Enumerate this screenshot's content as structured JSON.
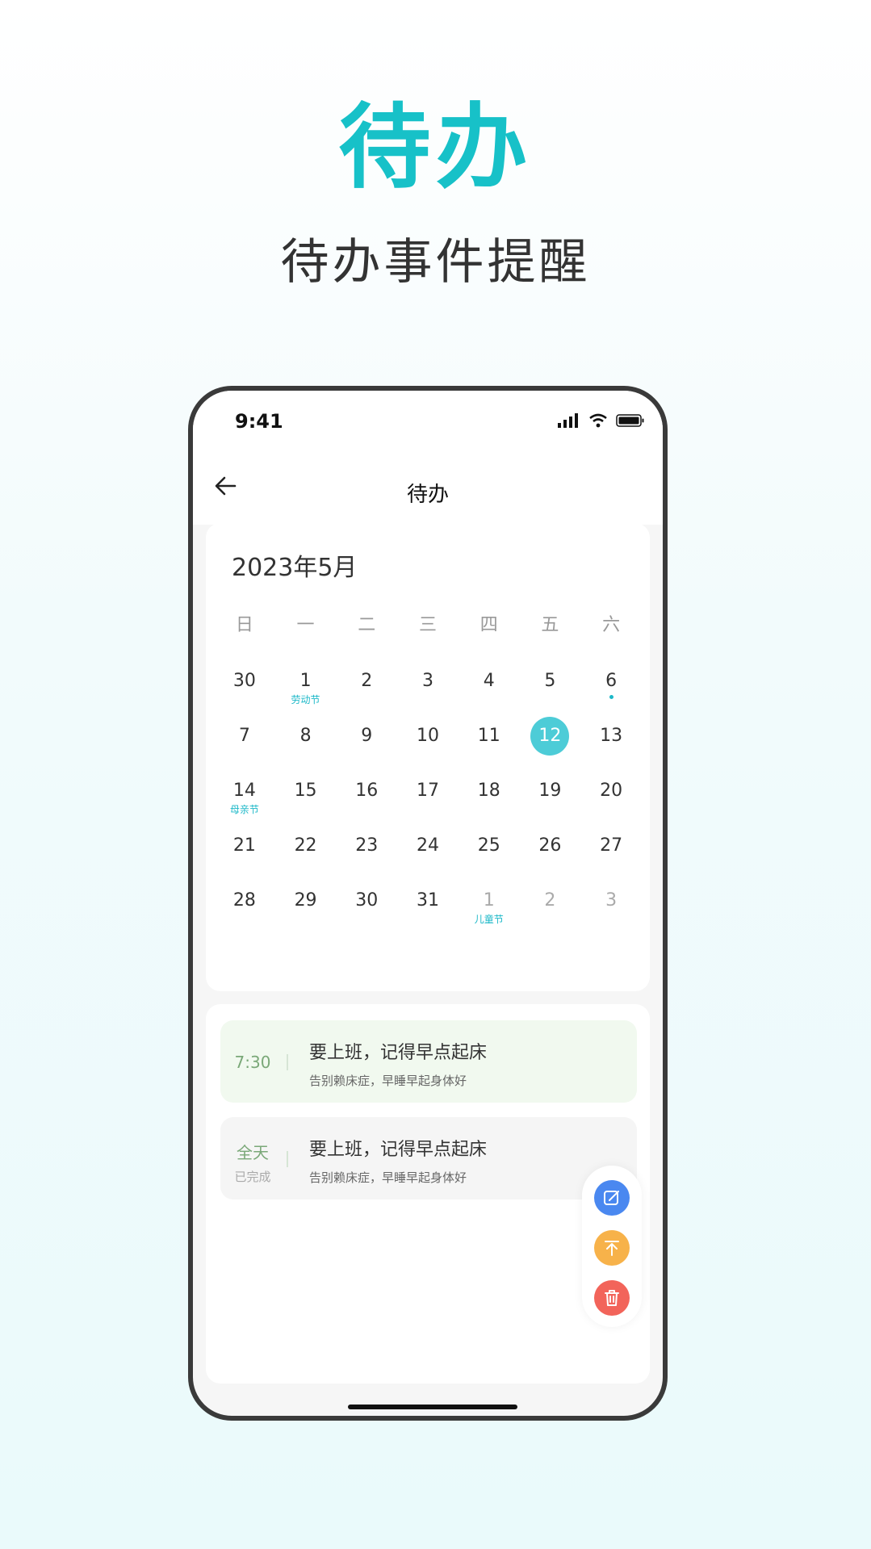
{
  "hero": {
    "title": "待办",
    "subtitle": "待办事件提醒"
  },
  "status_bar": {
    "time": "9:41"
  },
  "nav": {
    "title": "待办"
  },
  "calendar": {
    "month_label": "2023年5月",
    "weekdays": [
      "日",
      "一",
      "二",
      "三",
      "四",
      "五",
      "六"
    ],
    "days": [
      {
        "num": "30",
        "muted": false,
        "note": ""
      },
      {
        "num": "1",
        "muted": false,
        "note": "劳动节"
      },
      {
        "num": "2",
        "muted": false,
        "note": ""
      },
      {
        "num": "3",
        "muted": false,
        "note": ""
      },
      {
        "num": "4",
        "muted": false,
        "note": ""
      },
      {
        "num": "5",
        "muted": false,
        "note": ""
      },
      {
        "num": "6",
        "muted": false,
        "note": "",
        "dot": true
      },
      {
        "num": "7",
        "muted": false,
        "note": ""
      },
      {
        "num": "8",
        "muted": false,
        "note": ""
      },
      {
        "num": "9",
        "muted": false,
        "note": ""
      },
      {
        "num": "10",
        "muted": false,
        "note": ""
      },
      {
        "num": "11",
        "muted": false,
        "note": ""
      },
      {
        "num": "12",
        "muted": false,
        "note": "",
        "selected": true
      },
      {
        "num": "13",
        "muted": false,
        "note": ""
      },
      {
        "num": "14",
        "muted": false,
        "note": "母亲节"
      },
      {
        "num": "15",
        "muted": false,
        "note": ""
      },
      {
        "num": "16",
        "muted": false,
        "note": ""
      },
      {
        "num": "17",
        "muted": false,
        "note": ""
      },
      {
        "num": "18",
        "muted": false,
        "note": ""
      },
      {
        "num": "19",
        "muted": false,
        "note": ""
      },
      {
        "num": "20",
        "muted": false,
        "note": ""
      },
      {
        "num": "21",
        "muted": false,
        "note": ""
      },
      {
        "num": "22",
        "muted": false,
        "note": ""
      },
      {
        "num": "23",
        "muted": false,
        "note": ""
      },
      {
        "num": "24",
        "muted": false,
        "note": ""
      },
      {
        "num": "25",
        "muted": false,
        "note": ""
      },
      {
        "num": "26",
        "muted": false,
        "note": ""
      },
      {
        "num": "27",
        "muted": false,
        "note": ""
      },
      {
        "num": "28",
        "muted": false,
        "note": ""
      },
      {
        "num": "29",
        "muted": false,
        "note": ""
      },
      {
        "num": "30",
        "muted": false,
        "note": ""
      },
      {
        "num": "31",
        "muted": false,
        "note": ""
      },
      {
        "num": "1",
        "muted": true,
        "note": "儿童节"
      },
      {
        "num": "2",
        "muted": true,
        "note": ""
      },
      {
        "num": "3",
        "muted": true,
        "note": ""
      }
    ]
  },
  "todos": [
    {
      "time": "7:30",
      "title": "要上班，记得早点起床",
      "desc": "告别赖床症，早睡早起身体好"
    },
    {
      "time": "全天",
      "status": "已完成",
      "title": "要上班，记得早点起床",
      "desc": "告别赖床症，早睡早起身体好"
    }
  ],
  "icons": {
    "edit": "edit-icon",
    "top": "pin-top-icon",
    "delete": "trash-icon"
  },
  "colors": {
    "accent": "#17c1c8",
    "selected_day": "#4dccd7",
    "edit": "#4a88f0",
    "top": "#f7b24a",
    "delete": "#f2645a"
  }
}
